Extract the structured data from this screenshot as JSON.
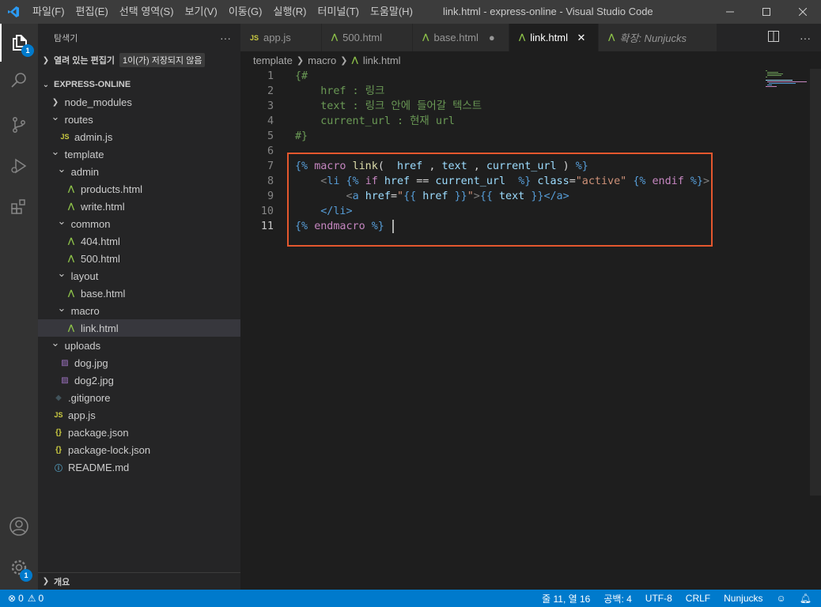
{
  "titlebar": {
    "menu": [
      "파일(F)",
      "편집(E)",
      "선택 영역(S)",
      "보기(V)",
      "이동(G)",
      "실행(R)",
      "터미널(T)",
      "도움말(H)"
    ],
    "title": "link.html - express-online - Visual Studio Code"
  },
  "activity": {
    "explorer_badge": "1",
    "settings_badge": "1"
  },
  "sidebar": {
    "header": "탐색기",
    "more": "···",
    "open_editors": "열려 있는 편집기",
    "unsaved_badge": "1이(가) 저장되지 않음",
    "project": "EXPRESS-ONLINE",
    "tree": [
      {
        "label": "node_modules",
        "depth": 0,
        "type": "folder",
        "open": false
      },
      {
        "label": "routes",
        "depth": 0,
        "type": "folder",
        "open": true
      },
      {
        "label": "admin.js",
        "depth": 1,
        "type": "js"
      },
      {
        "label": "template",
        "depth": 0,
        "type": "folder",
        "open": true
      },
      {
        "label": "admin",
        "depth": 1,
        "type": "folder",
        "open": true
      },
      {
        "label": "products.html",
        "depth": 2,
        "type": "html"
      },
      {
        "label": "write.html",
        "depth": 2,
        "type": "html"
      },
      {
        "label": "common",
        "depth": 1,
        "type": "folder",
        "open": true
      },
      {
        "label": "404.html",
        "depth": 2,
        "type": "html"
      },
      {
        "label": "500.html",
        "depth": 2,
        "type": "html"
      },
      {
        "label": "layout",
        "depth": 1,
        "type": "folder",
        "open": true
      },
      {
        "label": "base.html",
        "depth": 2,
        "type": "html"
      },
      {
        "label": "macro",
        "depth": 1,
        "type": "folder",
        "open": true
      },
      {
        "label": "link.html",
        "depth": 2,
        "type": "html",
        "selected": true
      },
      {
        "label": "uploads",
        "depth": 0,
        "type": "folder",
        "open": true
      },
      {
        "label": "dog.jpg",
        "depth": 1,
        "type": "img"
      },
      {
        "label": "dog2.jpg",
        "depth": 1,
        "type": "img"
      },
      {
        "label": ".gitignore",
        "depth": 0,
        "type": "git"
      },
      {
        "label": "app.js",
        "depth": 0,
        "type": "js"
      },
      {
        "label": "package.json",
        "depth": 0,
        "type": "json"
      },
      {
        "label": "package-lock.json",
        "depth": 0,
        "type": "json"
      },
      {
        "label": "README.md",
        "depth": 0,
        "type": "md"
      }
    ],
    "outline": "개요"
  },
  "tabs": [
    {
      "label": "app.js",
      "type": "js",
      "active": false,
      "state": ""
    },
    {
      "label": "500.html",
      "type": "html",
      "active": false,
      "state": ""
    },
    {
      "label": "base.html",
      "type": "html",
      "active": false,
      "state": "●"
    },
    {
      "label": "link.html",
      "type": "html",
      "active": true,
      "state": "✕"
    },
    {
      "label": "확장: Nunjucks",
      "type": "ext",
      "active": false,
      "state": ""
    }
  ],
  "breadcrumb": [
    "template",
    "macro",
    "link.html"
  ],
  "code": {
    "line_numbers": [
      "1",
      "2",
      "3",
      "4",
      "5",
      "6",
      "7",
      "8",
      "9",
      "10",
      "11"
    ],
    "comment": {
      "open": "{#",
      "l2": "    href : 링크",
      "l3": "    text : 링크 안에 들어갈 텍스트",
      "l4": "    current_url : 현재 url",
      "close": "#}"
    },
    "l7": {
      "open": "{%",
      "kw": "macro",
      "fn": "link",
      "p1": "(",
      "a1": "href",
      "c1": ",",
      "a2": "text",
      "c2": ",",
      "a3": "current_url",
      "p2": ")",
      "close": "%}"
    },
    "l8": {
      "lt": "<",
      "tag": "li",
      "t_open": "{%",
      "kw_if": "if",
      "v1": "href",
      "op": "==",
      "v2": "current_url",
      "t_close": "%}",
      "attr": "class",
      "eq": "=",
      "val": "\"active\"",
      "t_open2": "{%",
      "kw_endif": "endif",
      "t_close2": "%}",
      "gt": ">"
    },
    "l9": {
      "lt": "<",
      "tag": "a",
      "attr": "href",
      "eq": "=",
      "q1": "\"",
      "o1": "{{",
      "v1": "href",
      "c1": "}}",
      "q2": "\"",
      "gt": ">",
      "o2": "{{",
      "v2": "text",
      "c2": "}}",
      "close_tag": "</a>"
    },
    "l10": {
      "close_tag": "</li>"
    },
    "l11": {
      "open": "{%",
      "kw": "endmacro",
      "close": "%}"
    }
  },
  "statusbar": {
    "errors": "0",
    "warnings": "0",
    "position": "줄 11, 열 16",
    "spaces": "공백: 4",
    "encoding": "UTF-8",
    "eol": "CRLF",
    "language": "Nunjucks"
  }
}
